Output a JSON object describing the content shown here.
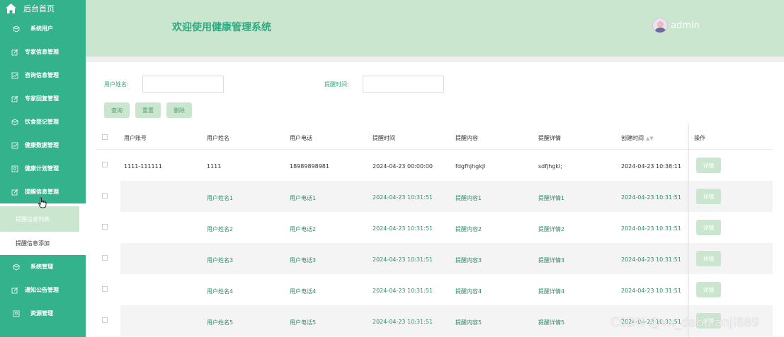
{
  "sidebar": {
    "home": "后台首页",
    "items": [
      {
        "label": "系统用户",
        "icon": "cube-icon"
      },
      {
        "label": "专家信息管理",
        "icon": "edit-icon"
      },
      {
        "label": "咨询信息管理",
        "icon": "chart-icon"
      },
      {
        "label": "专家回复管理",
        "icon": "edit-icon"
      },
      {
        "label": "饮食登记管理",
        "icon": "cube-icon"
      },
      {
        "label": "健康数据管理",
        "icon": "chart-icon"
      },
      {
        "label": "健康计划管理",
        "icon": "image-icon"
      },
      {
        "label": "提醒信息管理",
        "icon": "edit-icon"
      }
    ],
    "submenu": [
      "提醒信息列表",
      "提醒信息添加"
    ],
    "items_after": [
      {
        "label": "系统管理",
        "icon": "cube-icon"
      },
      {
        "label": "通知公告管理",
        "icon": "edit-icon"
      },
      {
        "label": "资源管理",
        "icon": "image-icon"
      }
    ]
  },
  "header": {
    "title": "欢迎使用健康管理系统",
    "user": "admin"
  },
  "search": {
    "name_label": "用户姓名:",
    "time_label": "提醒时间:",
    "name_value": "",
    "time_value": ""
  },
  "buttons": {
    "query": "查询",
    "reset": "重置",
    "delete": "删除"
  },
  "table": {
    "headers": [
      "用户账号",
      "用户姓名",
      "用户电话",
      "提醒时间",
      "提醒内容",
      "提醒详情",
      "创建时间",
      "操作"
    ],
    "detail_label": "详情",
    "rows": [
      [
        "1111-111111",
        "1111",
        "18989898981",
        "2024-04-23 00:00:00",
        "fdgfhjhgkjl",
        "sdfjhgkl;",
        "2024-04-23 10:38:11"
      ],
      [
        "",
        "用户姓名1",
        "用户电话1",
        "2024-04-23 10:31:51",
        "提醒内容1",
        "提醒详情1",
        "2024-04-23 10:31:51"
      ],
      [
        "",
        "用户姓名2",
        "用户电话2",
        "2024-04-23 10:31:51",
        "提醒内容2",
        "提醒详情2",
        "2024-04-23 10:31:51"
      ],
      [
        "",
        "用户姓名3",
        "用户电话3",
        "2024-04-23 10:31:51",
        "提醒内容3",
        "提醒详情3",
        "2024-04-23 10:31:51"
      ],
      [
        "",
        "用户姓名4",
        "用户电话4",
        "2024-04-23 10:31:51",
        "提醒内容4",
        "提醒详情4",
        "2024-04-23 10:31:51"
      ],
      [
        "",
        "用户姓名5",
        "用户电话5",
        "2024-04-23 10:31:51",
        "提醒内容5",
        "提醒详情5",
        "2024-04-23 10:31:51"
      ]
    ]
  },
  "watermark": "CSDN @vx_dabpianji889"
}
